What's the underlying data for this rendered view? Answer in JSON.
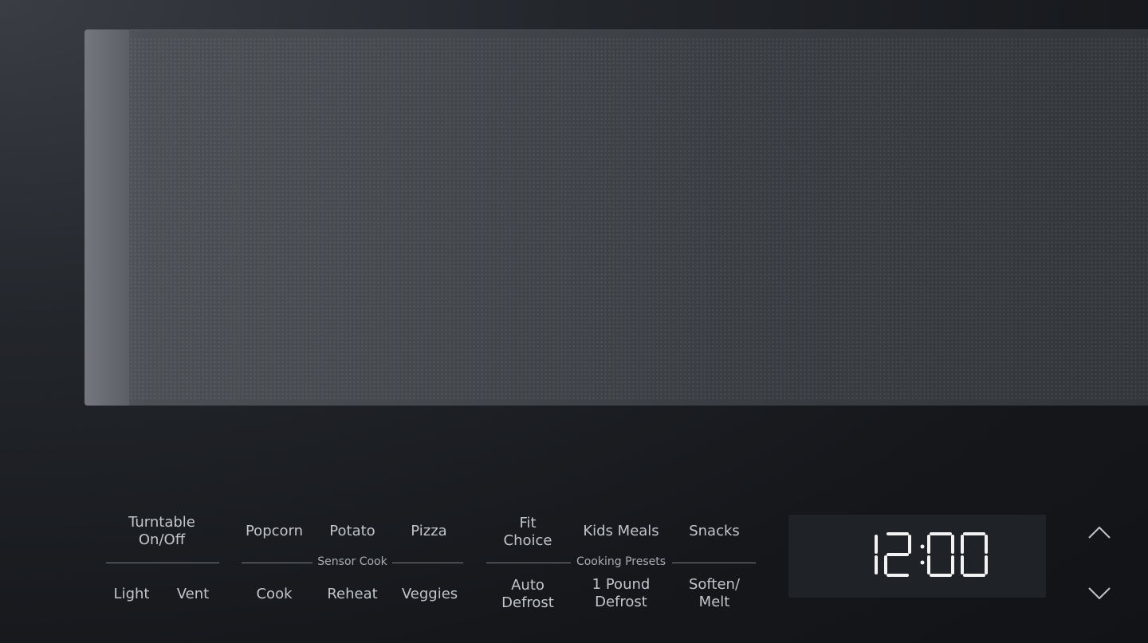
{
  "window": {},
  "panel": {
    "turntable": "Turntable\nOn/Off",
    "light": "Light",
    "vent": "Vent",
    "sensor_cook": {
      "label": "Sensor Cook",
      "top": [
        "Popcorn",
        "Potato",
        "Pizza"
      ],
      "bottom": [
        "Cook",
        "Reheat",
        "Veggies"
      ]
    },
    "cooking_presets": {
      "label": "Cooking Presets",
      "top": [
        "Fit\nChoice",
        "Kids Meals",
        "Snacks"
      ],
      "bottom": [
        "Auto\nDefrost",
        "1 Pound\nDefrost",
        "Soften/\nMelt"
      ]
    },
    "display": {
      "time": "12:00",
      "color": "#f2f2f2"
    },
    "controls": {
      "up_icon": "chevron-up-icon",
      "down_icon": "chevron-down-icon"
    }
  }
}
